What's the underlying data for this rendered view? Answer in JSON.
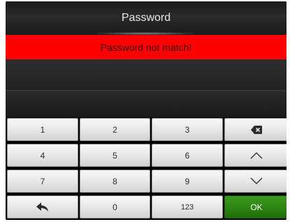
{
  "header": {
    "title": "Password"
  },
  "banner": {
    "error_text": "Password not match!",
    "color": "#ff0000"
  },
  "keypad": {
    "keys": [
      {
        "label": "1"
      },
      {
        "label": "2"
      },
      {
        "label": "3"
      },
      {
        "icon": "backspace-icon"
      },
      {
        "label": "4"
      },
      {
        "label": "5"
      },
      {
        "label": "6"
      },
      {
        "icon": "chevron-up-icon"
      },
      {
        "label": "7"
      },
      {
        "label": "8"
      },
      {
        "label": "9"
      },
      {
        "icon": "chevron-down-icon"
      },
      {
        "icon": "back-arrow-icon"
      },
      {
        "label": "0"
      },
      {
        "label": "123"
      },
      {
        "label": "OK"
      }
    ],
    "ok_color": "#2c8512"
  }
}
